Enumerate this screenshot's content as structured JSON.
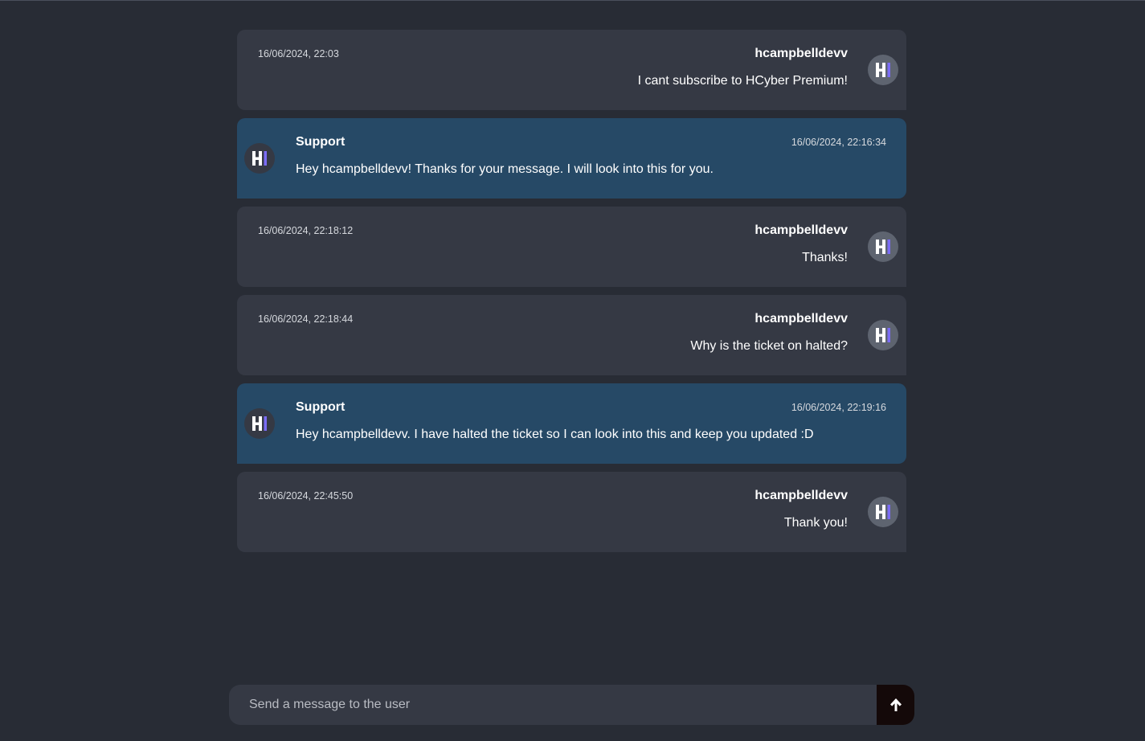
{
  "messages": [
    {
      "role": "user",
      "author": "hcampbelldevv",
      "timestamp": "16/06/2024, 22:03",
      "text": "I cant subscribe to HCyber Premium!",
      "avatar_icon": "hcyber-logo-icon"
    },
    {
      "role": "support",
      "author": "Support",
      "timestamp": "16/06/2024, 22:16:34",
      "text": "Hey hcampbelldevv! Thanks for your message. I will look into this for you.",
      "avatar_icon": "hcyber-logo-icon"
    },
    {
      "role": "user",
      "author": "hcampbelldevv",
      "timestamp": "16/06/2024, 22:18:12",
      "text": "Thanks!",
      "avatar_icon": "hcyber-logo-icon"
    },
    {
      "role": "user",
      "author": "hcampbelldevv",
      "timestamp": "16/06/2024, 22:18:44",
      "text": "Why is the ticket on halted?",
      "avatar_icon": "hcyber-logo-icon"
    },
    {
      "role": "support",
      "author": "Support",
      "timestamp": "16/06/2024, 22:19:16",
      "text": "Hey hcampbelldevv. I have halted the ticket so I can look into this and keep you updated :D",
      "avatar_icon": "hcyber-logo-icon"
    },
    {
      "role": "user",
      "author": "hcampbelldevv",
      "timestamp": "16/06/2024, 22:45:50",
      "text": "Thank you!",
      "avatar_icon": "hcyber-logo-icon"
    }
  ],
  "composer": {
    "placeholder": "Send a message to the user",
    "value": "",
    "send_icon": "arrow-up-icon"
  },
  "colors": {
    "background": "#282c35",
    "user_bubble": "#353944",
    "support_bubble": "#264966",
    "send_button": "#140909",
    "logo_accent": "#7b6cf6"
  }
}
